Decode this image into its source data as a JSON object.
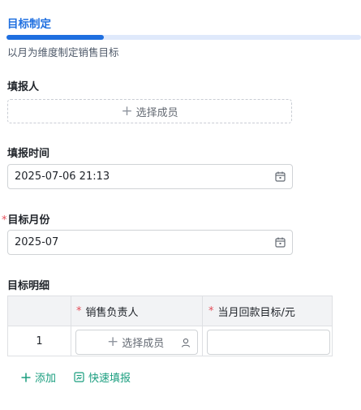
{
  "tab": {
    "title": "目标制定",
    "subtitle": "以月为维度制定销售目标"
  },
  "reporter": {
    "label": "填报人",
    "add_label": "选择成员"
  },
  "report_time": {
    "label": "填报时间",
    "value": "2025-07-06 21:13"
  },
  "target_month": {
    "label": "目标月份",
    "required_mark": "*",
    "value": "2025-07"
  },
  "details": {
    "label": "目标明细",
    "columns": [
      {
        "label": "销售负责人",
        "required_mark": "*"
      },
      {
        "label": "当月回款目标/元",
        "required_mark": "*"
      }
    ],
    "rows": [
      {
        "index": "1",
        "owner_placeholder": "选择成员",
        "target_value": ""
      }
    ]
  },
  "actions": {
    "add": "添加",
    "quick_fill": "快速填报"
  },
  "colors": {
    "accent": "#1f6fe0",
    "action": "#1a9e7f",
    "required": "#e34d59"
  },
  "icons": [
    "plus-icon",
    "calendar-icon",
    "person-icon",
    "quick-fill-icon"
  ]
}
